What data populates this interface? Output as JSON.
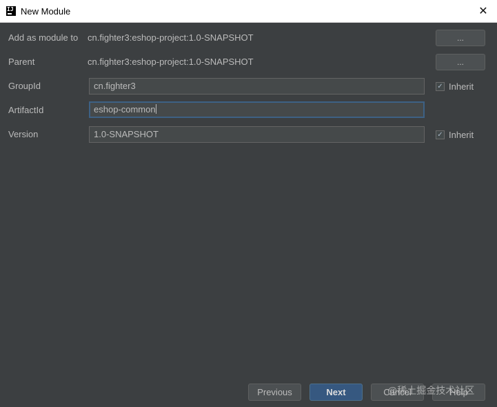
{
  "window": {
    "title": "New Module",
    "app_icon_text": "IJ"
  },
  "form": {
    "add_as_module_to": {
      "label": "Add as module to",
      "value": "cn.fighter3:eshop-project:1.0-SNAPSHOT",
      "button_label": "..."
    },
    "parent": {
      "label": "Parent",
      "value": "cn.fighter3:eshop-project:1.0-SNAPSHOT",
      "button_label": "..."
    },
    "group_id": {
      "label": "GroupId",
      "value": "cn.fighter3",
      "inherit_label": "Inherit",
      "inherit_checked": true
    },
    "artifact_id": {
      "label": "ArtifactId",
      "value": "eshop-common"
    },
    "version": {
      "label": "Version",
      "value": "1.0-SNAPSHOT",
      "inherit_label": "Inherit",
      "inherit_checked": true
    }
  },
  "footer": {
    "previous_label": "Previous",
    "next_label": "Next",
    "cancel_label": "Cancel",
    "help_label": "Help"
  },
  "watermark": "@稀土掘金技术社区",
  "icons": {
    "check": "✓",
    "close": "✕"
  }
}
